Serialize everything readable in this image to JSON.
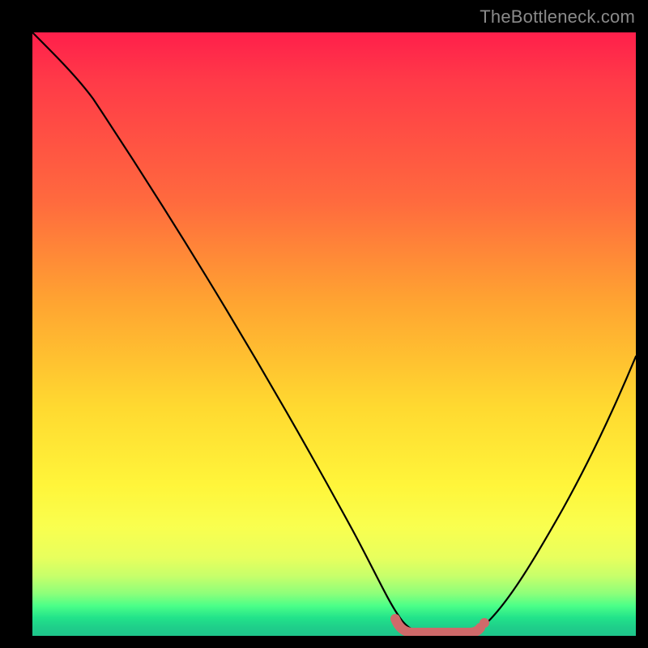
{
  "watermark": {
    "text": "TheBottleneck.com"
  },
  "chart_data": {
    "type": "line",
    "title": "",
    "xlabel": "",
    "ylabel": "",
    "xlim": [
      0,
      100
    ],
    "ylim": [
      0,
      100
    ],
    "series": [
      {
        "name": "curve",
        "x": [
          0,
          5,
          10,
          15,
          20,
          25,
          30,
          35,
          40,
          45,
          50,
          55,
          58,
          60,
          62,
          65,
          68,
          70,
          72,
          75,
          78,
          82,
          86,
          90,
          94,
          98,
          100
        ],
        "y": [
          100,
          95,
          89,
          82,
          75,
          68,
          60,
          52,
          44,
          36,
          27,
          18,
          12,
          8,
          4,
          2,
          1,
          1,
          1,
          2,
          4,
          8,
          14,
          22,
          32,
          44,
          51
        ]
      }
    ],
    "annotations": {
      "flat_band": {
        "x_start": 60,
        "x_end": 73,
        "y": 1,
        "color": "#d97a7a"
      }
    },
    "background_gradient": {
      "top": "#ff1f4b",
      "mid1": "#ffa531",
      "mid2": "#fff53a",
      "bottom": "#1ec58a"
    }
  }
}
